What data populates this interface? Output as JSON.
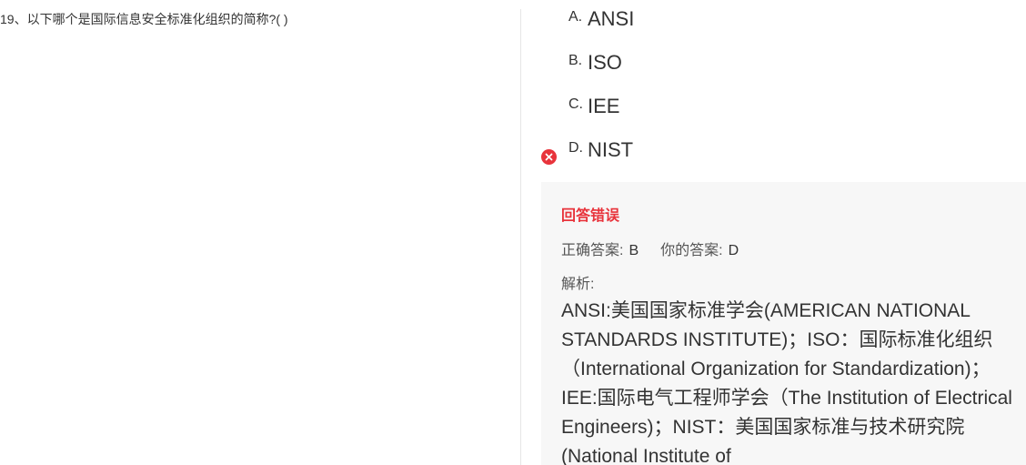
{
  "question": {
    "text": "19、以下哪个是国际信息安全标准化组织的简称?( )"
  },
  "options": [
    {
      "letter": "A.",
      "text": "ANSI"
    },
    {
      "letter": "B.",
      "text": "ISO"
    },
    {
      "letter": "C.",
      "text": "IEE"
    },
    {
      "letter": "D.",
      "text": "NIST"
    }
  ],
  "result": {
    "title": "回答错误",
    "correct_label": "正确答案:",
    "correct_value": "B",
    "your_label": "你的答案:",
    "your_value": "D",
    "analysis_label": "解析:",
    "analysis_text": "ANSI:美国国家标准学会(AMERICAN NATIONAL STANDARDS INSTITUTE)；ISO：国际标准化组织（International Organization for Standardization)；IEE:国际电气工程师学会（The Institution of Electrical Engineers)；NIST：美国国家标准与技术研究院(National Institute of"
  },
  "icons": {
    "wrong_icon": "x-circle-icon"
  },
  "colors": {
    "error": "#e8333b",
    "result_bg": "#f7f7f7"
  }
}
